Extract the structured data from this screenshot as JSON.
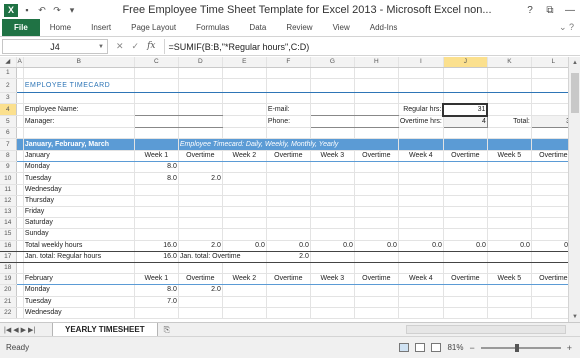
{
  "window": {
    "title": "Free Employee Time Sheet Template for Excel 2013  -  Microsoft Excel non...",
    "app_logo": "X",
    "controls": {
      "help": "?",
      "restore": "⧉",
      "minimize": "—",
      "maximize": "▢",
      "close": "✕"
    }
  },
  "ribbon": {
    "tabs": [
      "File",
      "Home",
      "Insert",
      "Page Layout",
      "Formulas",
      "Data",
      "Review",
      "View",
      "Add-Ins"
    ]
  },
  "formula_bar": {
    "name_box": "J4",
    "formula": "=SUMIF(B:B,\"*Regular hours\",C:D)",
    "fx": "fx"
  },
  "columns": [
    "A",
    "B",
    "C",
    "D",
    "E",
    "F",
    "G",
    "H",
    "I",
    "J",
    "K",
    "L"
  ],
  "selected_column": "J",
  "selected_row": "4",
  "sheet": {
    "title": "EMPLOYEE TIMECARD",
    "employee_name_label": "Employee Name:",
    "manager_label": "Manager:",
    "email_label": "E-mail:",
    "phone_label": "Phone:",
    "regular_hrs_label": "Regular hrs:",
    "overtime_hrs_label": "Overtime hrs:",
    "total_label": "Total:",
    "regular_hrs": "31",
    "overtime_hrs": "4",
    "total": "35",
    "banner_title": "January, February, March",
    "banner_subtitle": "Employee Timecard: Daily, Weekly, Monthly, Yearly",
    "header_cols": [
      "Week 1",
      "Overtime",
      "Week 2",
      "Overtime",
      "Week 3",
      "Overtime",
      "Week 4",
      "Overtime",
      "Week 5",
      "Overtime"
    ],
    "january": {
      "label": "January",
      "days": [
        {
          "day": "Monday",
          "w1": "8.0",
          "ot1": ""
        },
        {
          "day": "Tuesday",
          "w1": "8.0",
          "ot1": "2.0"
        },
        {
          "day": "Wednesday",
          "w1": "",
          "ot1": ""
        },
        {
          "day": "Thursday",
          "w1": "",
          "ot1": ""
        },
        {
          "day": "Friday",
          "w1": "",
          "ot1": ""
        },
        {
          "day": "Saturday",
          "w1": "",
          "ot1": ""
        },
        {
          "day": "Sunday",
          "w1": "",
          "ot1": ""
        }
      ],
      "total_weekly_label": "Total weekly hours",
      "totals": [
        "16.0",
        "2.0",
        "0.0",
        "0.0",
        "0.0",
        "0.0",
        "0.0",
        "0.0",
        "0.0",
        "0.0"
      ],
      "regular_total_label": "Jan. total: Regular hours",
      "regular_total": "16.0",
      "overtime_total_label": "Jan. total: Overtime",
      "overtime_total": "2.0"
    },
    "february": {
      "label": "February",
      "days": [
        {
          "day": "Monday",
          "w1": "8.0",
          "ot1": "2.0"
        },
        {
          "day": "Tuesday",
          "w1": "7.0",
          "ot1": ""
        },
        {
          "day": "Wednesday",
          "w1": "",
          "ot1": ""
        }
      ]
    }
  },
  "sheet_tabs": [
    "YEARLY TIMESHEET"
  ],
  "status": {
    "ready": "Ready",
    "zoom": "81%",
    "zoom_out": "−",
    "zoom_in": "+"
  },
  "colors": {
    "accent": "#1f7244",
    "banner": "#5b9bd5",
    "title": "#2e75b6"
  }
}
